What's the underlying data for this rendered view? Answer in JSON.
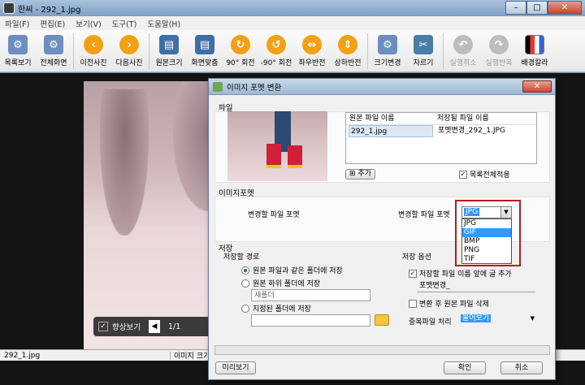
{
  "window": {
    "title": "한씨 - 292_1.jpg"
  },
  "menu": [
    "파일(F)",
    "편집(E)",
    "보기(V)",
    "도구(T)",
    "도움말(H)"
  ],
  "toolbar": [
    {
      "label": "목록보기",
      "icon": "list-icon",
      "enabled": true
    },
    {
      "label": "전체화면",
      "icon": "fullscreen-icon",
      "enabled": true
    },
    {
      "label": "이전사진",
      "icon": "prev-arrow-icon",
      "enabled": true
    },
    {
      "label": "다음사진",
      "icon": "next-arrow-icon",
      "enabled": true
    },
    {
      "label": "원본크기",
      "icon": "original-size-icon",
      "enabled": true
    },
    {
      "label": "화면맞춤",
      "icon": "fit-screen-icon",
      "enabled": true
    },
    {
      "label": "90° 회전",
      "icon": "rotate-right-icon",
      "enabled": true
    },
    {
      "label": "-90° 회전",
      "icon": "rotate-left-icon",
      "enabled": true
    },
    {
      "label": "좌우반전",
      "icon": "flip-horizontal-icon",
      "enabled": true
    },
    {
      "label": "상하반전",
      "icon": "flip-vertical-icon",
      "enabled": true
    },
    {
      "label": "크기변경",
      "icon": "resize-icon",
      "enabled": true
    },
    {
      "label": "자르기",
      "icon": "crop-icon",
      "enabled": true
    },
    {
      "label": "실행취소",
      "icon": "undo-icon",
      "enabled": false
    },
    {
      "label": "실행반복",
      "icon": "redo-icon",
      "enabled": false
    },
    {
      "label": "배경칼라",
      "icon": "background-color-icon",
      "enabled": true
    }
  ],
  "viewer": {
    "hq_label": "향상보기",
    "page": "1/1"
  },
  "status": {
    "filename": "292_1.jpg",
    "info": "이미지 크기"
  },
  "dialog": {
    "title": "이미지 포멧 변환",
    "file_section": "파일",
    "col_original": "원본 파일 이름",
    "col_saved": "저장될 파일 이름",
    "original_file": "292_1.jpg",
    "saved_file": "포멧변경_292_1.JPG",
    "add_button": "추가",
    "apply_all": "목록전체적용",
    "format_section": "이미지포멧",
    "format_label_left": "변경할 파일 포멧",
    "format_label_right": "변경할 파일 포멧",
    "format_selected": "JPG",
    "format_options": [
      "JPG",
      "GIF",
      "BMP",
      "PNG",
      "TIF"
    ],
    "format_highlighted": "GIF",
    "save_section": "저장",
    "save_path_label": "저장할 경로",
    "radio_same": "원본 파일과 같은 폴더에 저장",
    "radio_sub": "원본 하위 폴더에 저장",
    "subfolder_placeholder": "새폴더",
    "radio_custom": "지정된 폴더에 저장",
    "save_options_label": "저장 옵션",
    "prefix_label": "저장할 파일 이름 앞에 글 추가",
    "prefix_value": "포멧변경_",
    "delete_original": "변환 후 원본 파일 삭제",
    "duplicate_label": "중복파일 처리",
    "duplicate_value": "물어보기",
    "preview_button": "미리보기",
    "ok_button": "확인",
    "cancel_button": "취소"
  }
}
